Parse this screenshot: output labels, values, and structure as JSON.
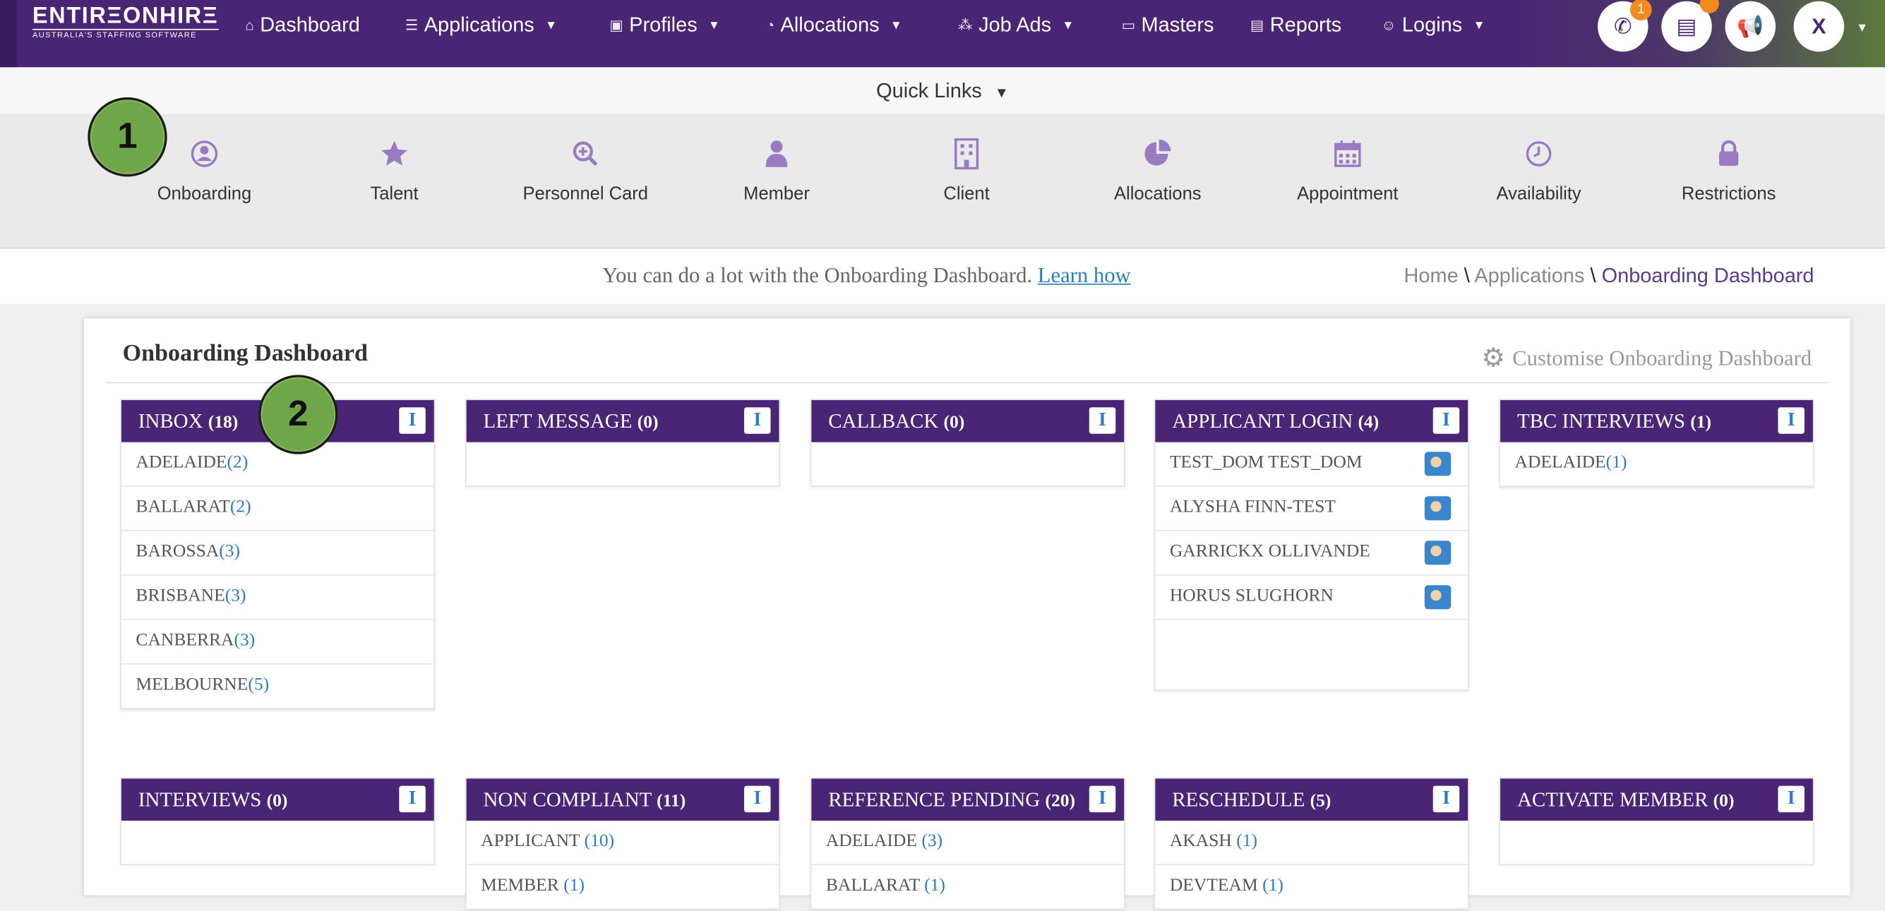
{
  "brand": {
    "name": "ENTIRΞONHIRΞ",
    "tagline": "AUSTRALIA'S STAFFING SOFTWARE"
  },
  "nav": [
    {
      "label": "Dashboard",
      "icon": "home-icon",
      "dropdown": false
    },
    {
      "label": "Applications",
      "icon": "list-icon",
      "dropdown": true
    },
    {
      "label": "Profiles",
      "icon": "id-card-icon",
      "dropdown": true
    },
    {
      "label": "Allocations",
      "icon": "pie-icon",
      "dropdown": true
    },
    {
      "label": "Job Ads",
      "icon": "network-icon",
      "dropdown": true
    },
    {
      "label": "Masters",
      "icon": "folder-icon",
      "dropdown": false
    },
    {
      "label": "Reports",
      "icon": "document-icon",
      "dropdown": false
    },
    {
      "label": "Logins",
      "icon": "user-icon",
      "dropdown": true
    }
  ],
  "header_actions": {
    "calls_badge": "1",
    "user_initial": "X"
  },
  "quick_links": {
    "label": "Quick Links",
    "items": [
      {
        "label": "Onboarding",
        "icon": "user-circle-icon"
      },
      {
        "label": "Talent",
        "icon": "star-icon"
      },
      {
        "label": "Personnel Card",
        "icon": "zoom-in-icon"
      },
      {
        "label": "Member",
        "icon": "person-icon"
      },
      {
        "label": "Client",
        "icon": "building-icon"
      },
      {
        "label": "Allocations",
        "icon": "pie-chart-icon"
      },
      {
        "label": "Appointment",
        "icon": "calendar-icon"
      },
      {
        "label": "Availability",
        "icon": "clock-icon"
      },
      {
        "label": "Restrictions",
        "icon": "lock-icon"
      }
    ]
  },
  "markers": [
    "1",
    "2"
  ],
  "info": {
    "text": "You can do a lot with the Onboarding Dashboard.",
    "link": "Learn how"
  },
  "breadcrumb": {
    "home": "Home",
    "sep": "\\",
    "section": "Applications",
    "current": "Onboarding Dashboard"
  },
  "dashboard": {
    "title": "Onboarding Dashboard",
    "customise": "Customise Onboarding Dashboard",
    "cards": [
      {
        "title": "INBOX",
        "count": "(18)",
        "rows": [
          {
            "name": "ADELAIDE",
            "n": "(2)"
          },
          {
            "name": "BALLARAT",
            "n": "(2)"
          },
          {
            "name": "BAROSSA",
            "n": "(3)"
          },
          {
            "name": "BRISBANE",
            "n": "(3)"
          },
          {
            "name": "CANBERRA",
            "n": "(3)"
          },
          {
            "name": "MELBOURNE",
            "n": "(5)"
          }
        ]
      },
      {
        "title": "LEFT MESSAGE",
        "count": "(0)",
        "rows": []
      },
      {
        "title": "CALLBACK",
        "count": "(0)",
        "rows": []
      },
      {
        "title": "APPLICANT LOGIN",
        "count": "(4)",
        "rows": [
          {
            "name": "TEST_DOM TEST_DOM",
            "n": ""
          },
          {
            "name": "ALYSHA FINN-TEST",
            "n": ""
          },
          {
            "name": "GARRICKX OLLIVANDE",
            "n": ""
          },
          {
            "name": "HORUS SLUGHORN",
            "n": ""
          }
        ]
      },
      {
        "title": "TBC INTERVIEWS",
        "count": "(1)",
        "rows": [
          {
            "name": "ADELAIDE",
            "n": "(1)"
          }
        ]
      },
      {
        "title": "INTERVIEWS",
        "count": "(0)",
        "rows": []
      },
      {
        "title": "NON COMPLIANT",
        "count": "(11)",
        "rows": [
          {
            "name": "APPLICANT ",
            "n": "(10)"
          },
          {
            "name": "MEMBER ",
            "n": "(1)"
          }
        ]
      },
      {
        "title": "REFERENCE PENDING",
        "count": "(20)",
        "rows": [
          {
            "name": "ADELAIDE ",
            "n": "(3)"
          },
          {
            "name": "BALLARAT ",
            "n": "(1)"
          }
        ]
      },
      {
        "title": "RESCHEDULE",
        "count": "(5)",
        "rows": [
          {
            "name": "AKASH ",
            "n": "(1)"
          },
          {
            "name": "DEVTEAM ",
            "n": "(1)"
          }
        ]
      },
      {
        "title": "ACTIVATE MEMBER",
        "count": "(0)",
        "rows": []
      }
    ]
  }
}
